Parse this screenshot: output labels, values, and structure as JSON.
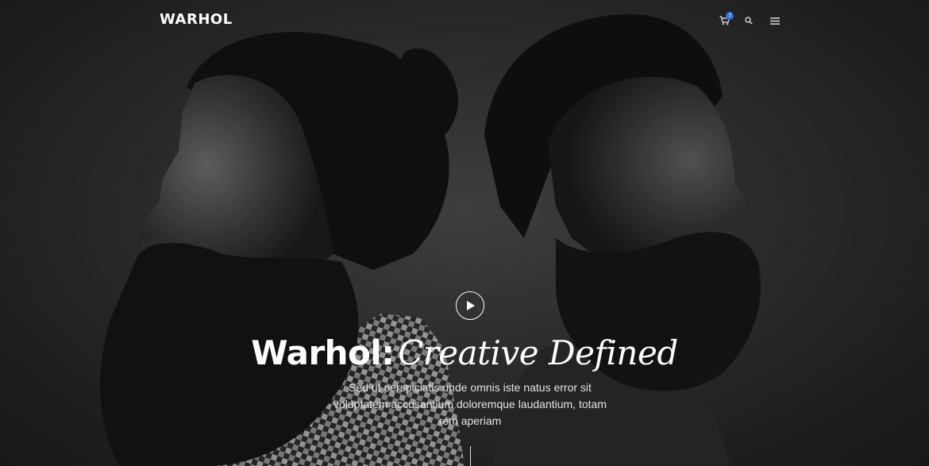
{
  "header": {
    "logo": "WARHOL",
    "cart_count": "3",
    "icons": [
      "cart-icon",
      "search-icon",
      "menu-icon"
    ]
  },
  "hero": {
    "title_bold": "Warhol:",
    "title_italic": "Creative Defined",
    "subtitle_lines": [
      "Sed ut perspiciatis unde omnis iste natus error sit",
      "voluptatem accusantium doloremque laudantium, totam",
      "rem aperiam"
    ],
    "play_icon": "play-icon"
  },
  "colors": {
    "background": "#2a2a2a",
    "text": "#ffffff",
    "badge": "#2f6fe0"
  }
}
